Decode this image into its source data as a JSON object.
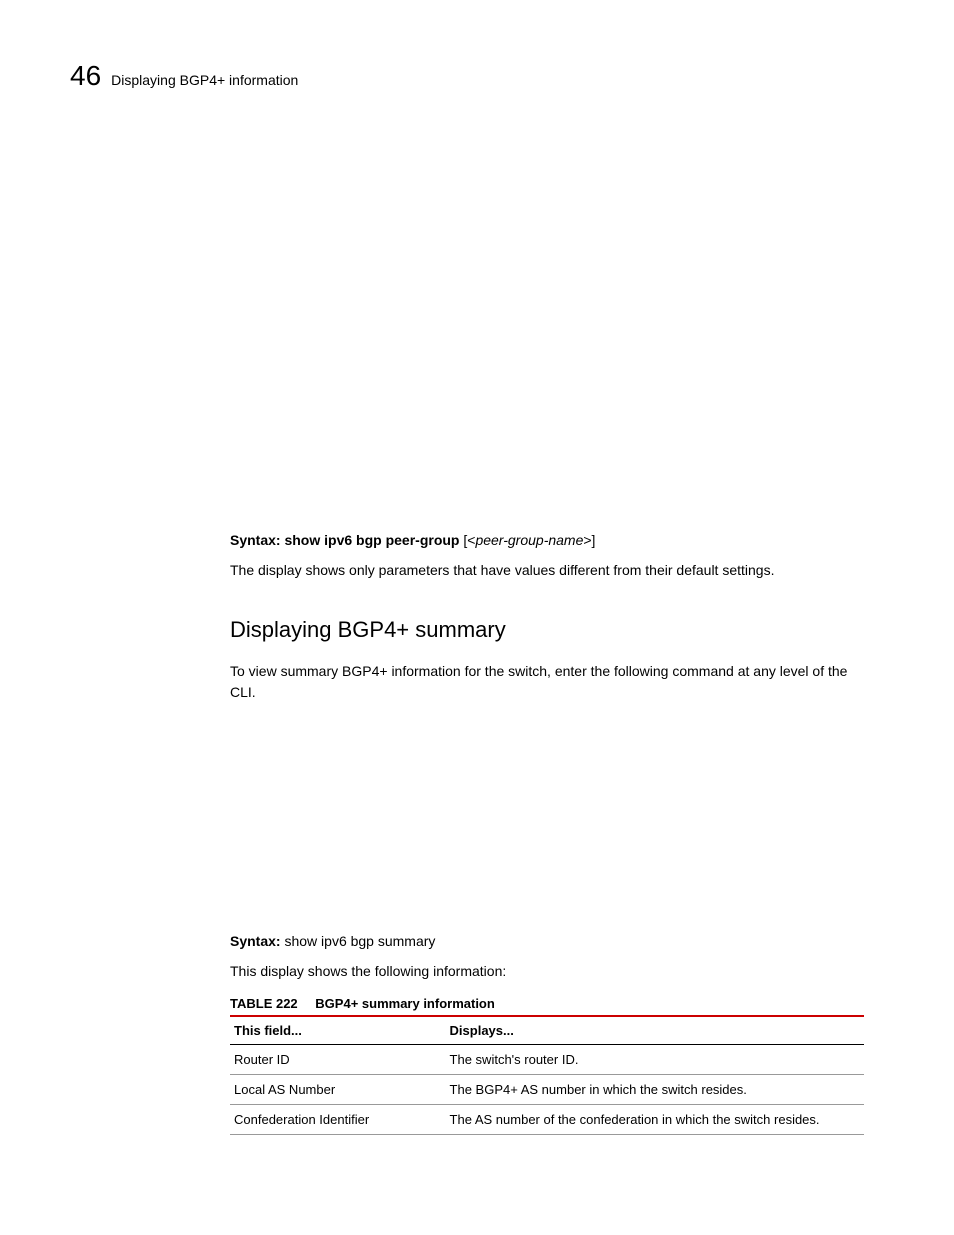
{
  "header": {
    "page_number": "46",
    "title": "Displaying BGP4+ information"
  },
  "syntax1": {
    "label": "Syntax:",
    "command": "show ipv6 bgp peer-group",
    "param_open": " [<",
    "param": "peer-group-name",
    "param_close": ">]"
  },
  "body1": "The display shows only parameters that have values different from their default settings.",
  "section": {
    "heading": "Displaying BGP4+ summary",
    "intro": "To view summary BGP4+ information for the switch, enter the following command at any level of the CLI."
  },
  "syntax2": {
    "label": "Syntax:",
    "command": "show ipv6 bgp summary"
  },
  "body2": "This display shows the following information:",
  "table": {
    "label": "TABLE 222",
    "title": "BGP4+ summary information",
    "headers": {
      "col1": "This field...",
      "col2": "Displays..."
    },
    "rows": [
      {
        "field": "Router ID",
        "desc": "The switch's router ID."
      },
      {
        "field": "Local AS Number",
        "desc": "The BGP4+ AS number in which the switch resides."
      },
      {
        "field": "Confederation Identifier",
        "desc": "The AS number of the confederation in which the switch resides."
      }
    ]
  }
}
